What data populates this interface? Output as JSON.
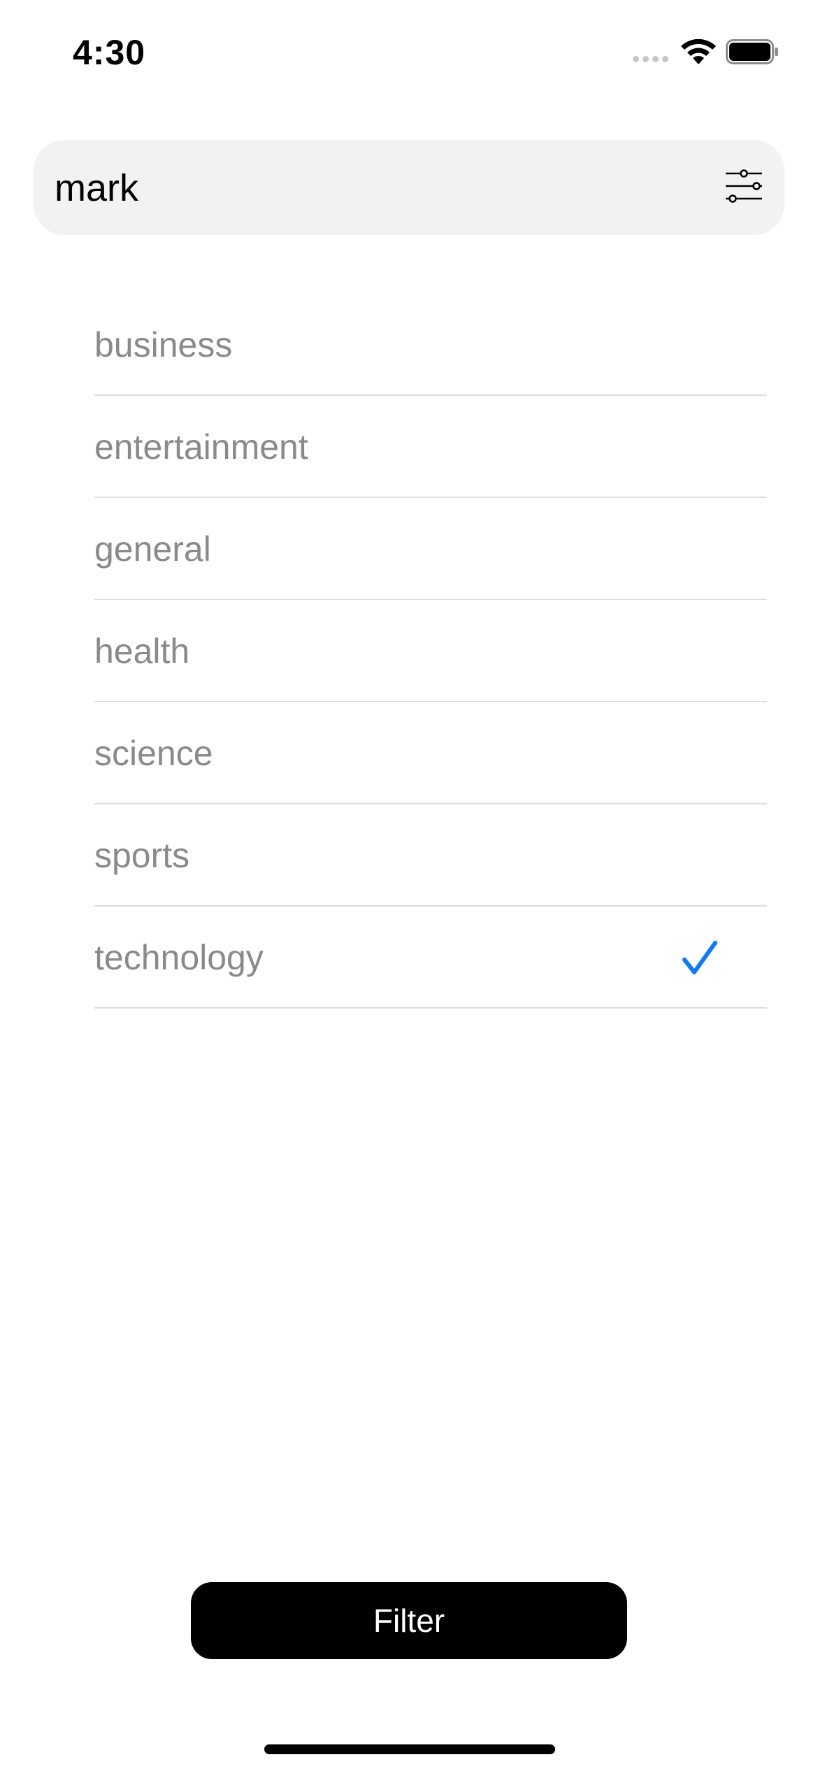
{
  "status_bar": {
    "time": "4:30"
  },
  "search": {
    "value": "mark",
    "icon": "sliders-icon"
  },
  "categories": {
    "items": [
      {
        "label": "business",
        "selected": false
      },
      {
        "label": "entertainment",
        "selected": false
      },
      {
        "label": "general",
        "selected": false
      },
      {
        "label": "health",
        "selected": false
      },
      {
        "label": "science",
        "selected": false
      },
      {
        "label": "sports",
        "selected": false
      },
      {
        "label": "technology",
        "selected": true
      }
    ]
  },
  "filter_button": {
    "label": "Filter"
  },
  "colors": {
    "accent": "#0a7aff",
    "label_gray": "#8a8a8a",
    "search_bg": "#f2f2f2",
    "separator": "#dcdcdc"
  }
}
